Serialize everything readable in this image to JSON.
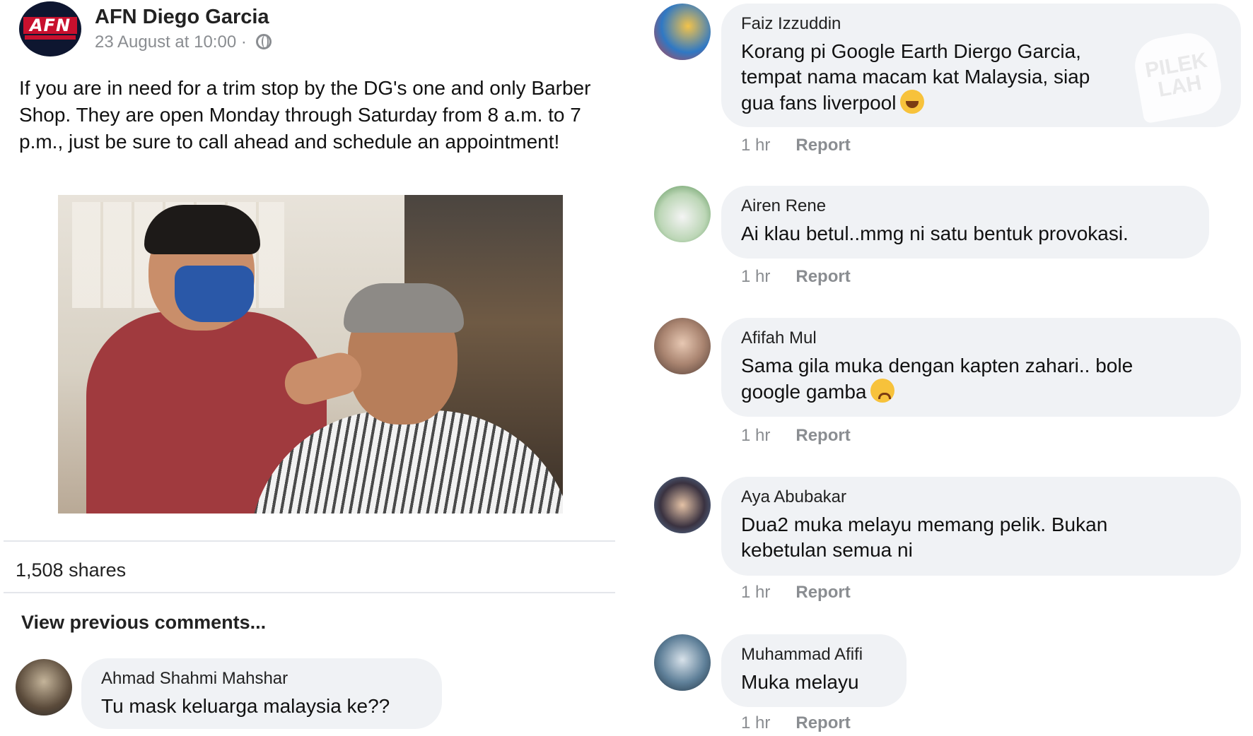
{
  "post": {
    "page_name": "AFN Diego Garcia",
    "logo_text": "AFN",
    "timestamp": "23 August at 10:00 ·",
    "text": "If you are in need for a trim stop by the DG's one and only Barber Shop. They are open Monday through Saturday from 8 a.m. to 7 p.m., just be sure to call ahead and schedule an appointment!",
    "privacy_icon": "globe-icon",
    "shares": "1,508 shares",
    "view_previous": "View previous comments..."
  },
  "comments_left": [
    {
      "name": "Ahmad Shahmi Mahshar",
      "text": "Tu mask keluarga malaysia ke??"
    }
  ],
  "comments_right": [
    {
      "name": "Faiz Izzuddin",
      "text_line1": "Korang pi Google Earth Diergo Garcia,",
      "text_line2": "tempat nama macam kat Malaysia, siap",
      "text_line3": "gua fans liverpool",
      "emoji": "laughing-emoji-icon",
      "time": "1 hr",
      "action": "Report"
    },
    {
      "name": "Airen Rene",
      "text": "Ai klau betul..mmg ni satu bentuk provokasi.",
      "time": "1 hr",
      "action": "Report"
    },
    {
      "name": "Afifah Mul",
      "text_line1": "Sama gila muka dengan kapten zahari.. bole",
      "text_line2": "google gamba",
      "emoji": "sad-emoji-icon",
      "time": "1 hr",
      "action": "Report"
    },
    {
      "name": "Aya Abubakar",
      "text_line1": "Dua2 muka melayu memang pelik. Bukan",
      "text_line2": "kebetulan semua ni",
      "time": "1 hr",
      "action": "Report"
    },
    {
      "name": "Muhammad Afifi",
      "text": "Muka melayu",
      "time": "1 hr",
      "action": "Report"
    }
  ],
  "watermark": {
    "line1": "PILEK",
    "line2": "LAH"
  },
  "colors": {
    "bubble": "#f0f2f5",
    "meta": "#8a8d91",
    "afn_red": "#c8102e"
  }
}
